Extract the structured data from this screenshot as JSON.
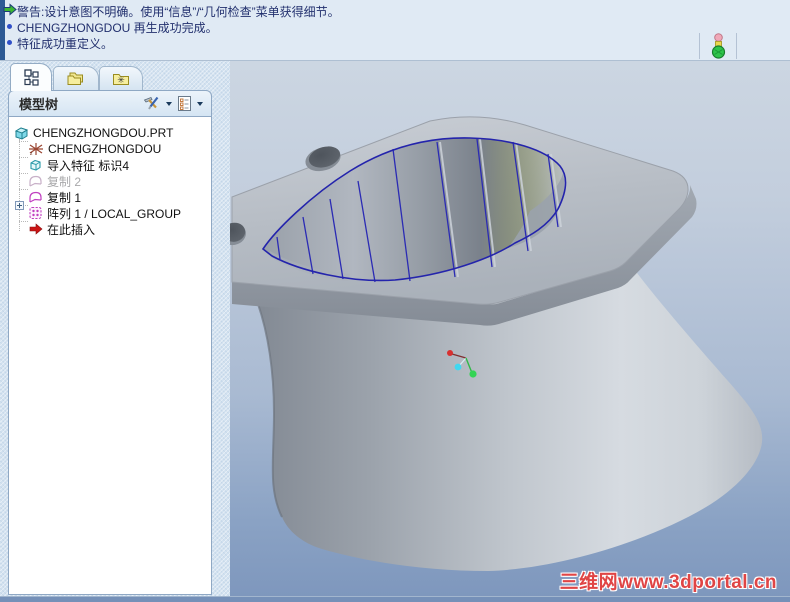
{
  "message_area": {
    "lines": [
      {
        "icon": "warning-arrow-icon",
        "text": "警告:设计意图不明确。使用“信息”/“几何检查”菜单获得细节。"
      },
      {
        "icon": "bullet-icon",
        "text": "CHENGZHONGDOU 再生成功完成。"
      },
      {
        "icon": "bullet-icon",
        "text": "特征成功重定义。"
      }
    ],
    "regen_status_icon": "traffic-light"
  },
  "navigator": {
    "tabs": [
      {
        "name": "model-tree",
        "icon": "model-tree-icon",
        "active": true
      },
      {
        "name": "folder-browser",
        "icon": "folders-icon",
        "active": false
      },
      {
        "name": "favorites",
        "icon": "favorites-folder-icon",
        "active": false
      }
    ],
    "header": {
      "title": "模型树",
      "tools": "settings-dropdown",
      "display": "show-dropdown"
    },
    "tree": [
      {
        "label": "CHENGZHONGDOU.PRT",
        "icon": "part-icon"
      },
      {
        "label": "CHENGZHONGDOU",
        "icon": "csys-icon"
      },
      {
        "label": "导入特征 标识4",
        "icon": "import-feature-icon"
      },
      {
        "label": "复制 2",
        "icon": "copy-icon",
        "suppressed": true
      },
      {
        "label": "复制 1",
        "icon": "copy-icon"
      },
      {
        "label": "阵列 1 / LOCAL_GROUP",
        "icon": "pattern-icon",
        "expandable": true
      },
      {
        "label": "在此插入",
        "icon": "insert-here-icon"
      }
    ]
  },
  "viewport": {
    "watermark": "三维网www.3dportal.cn",
    "model": "gray duct part with flange, airfoil opening and blue sketch ribs",
    "colors": {
      "sketch_blue": "#2b2bb4",
      "model_gray": "#b4bac2",
      "background_top": "#ccd6e2",
      "background_bottom": "#7e97bd",
      "watermark_red": "#e04545"
    }
  }
}
